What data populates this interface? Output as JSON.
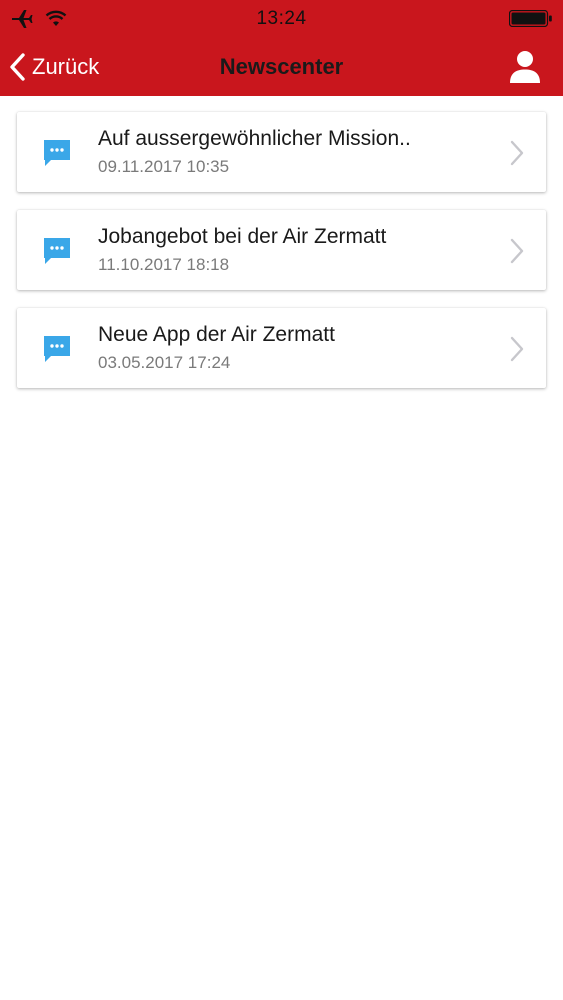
{
  "status_bar": {
    "time": "13:24"
  },
  "nav": {
    "back_label": "Zurück",
    "title": "Newscenter",
    "profile_icon": "person-icon"
  },
  "news": [
    {
      "title": "Auf aussergewöhnlicher Mission..",
      "date": "09.11.2017 10:35",
      "icon": "chat-bubble-icon"
    },
    {
      "title": "Jobangebot bei der Air Zermatt",
      "date": "11.10.2017 18:18",
      "icon": "chat-bubble-icon"
    },
    {
      "title": "Neue App der Air Zermatt",
      "date": "03.05.2017 17:24",
      "icon": "chat-bubble-icon"
    }
  ],
  "colors": {
    "header_background": "#c9161d",
    "message_icon": "#3aa7e8",
    "chevron": "#c7c7cc"
  }
}
